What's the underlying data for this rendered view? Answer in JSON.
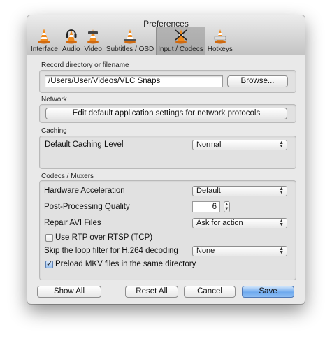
{
  "window": {
    "title": "Preferences"
  },
  "toolbar": {
    "tabs": [
      {
        "label": "Interface",
        "icon": "vlc-cone-icon"
      },
      {
        "label": "Audio",
        "icon": "headphones-cone-icon"
      },
      {
        "label": "Video",
        "icon": "video-cone-icon"
      },
      {
        "label": "Subtitles / OSD",
        "icon": "subtitles-cone-icon"
      },
      {
        "label": "Input / Codecs",
        "icon": "codecs-cone-icon",
        "active": true
      },
      {
        "label": "Hotkeys",
        "icon": "hotkeys-cone-icon"
      }
    ]
  },
  "record": {
    "section_title": "Record directory or filename",
    "path_value": "/Users/User/Videos/VLC Snaps",
    "browse_label": "Browse..."
  },
  "network": {
    "section_title": "Network",
    "button_label": "Edit default application settings for network protocols"
  },
  "caching": {
    "section_title": "Caching",
    "level_label": "Default Caching Level",
    "level_value": "Normal"
  },
  "codecs": {
    "section_title": "Codecs / Muxers",
    "hw_accel_label": "Hardware Acceleration",
    "hw_accel_value": "Default",
    "pp_quality_label": "Post-Processing Quality",
    "pp_quality_value": "6",
    "repair_avi_label": "Repair AVI Files",
    "repair_avi_value": "Ask for action",
    "rtp_label": "Use RTP over RTSP (TCP)",
    "rtp_checked": false,
    "skip_loop_label": "Skip the loop filter for H.264 decoding",
    "skip_loop_value": "None",
    "preload_mkv_label": "Preload MKV files in the same directory",
    "preload_mkv_checked": true
  },
  "footer": {
    "show_all": "Show All",
    "reset_all": "Reset All",
    "cancel": "Cancel",
    "save": "Save"
  },
  "colors": {
    "window_bg": "#e9e9e9",
    "default_button": "#6ea9ee",
    "cone_orange": "#f08a1c"
  }
}
